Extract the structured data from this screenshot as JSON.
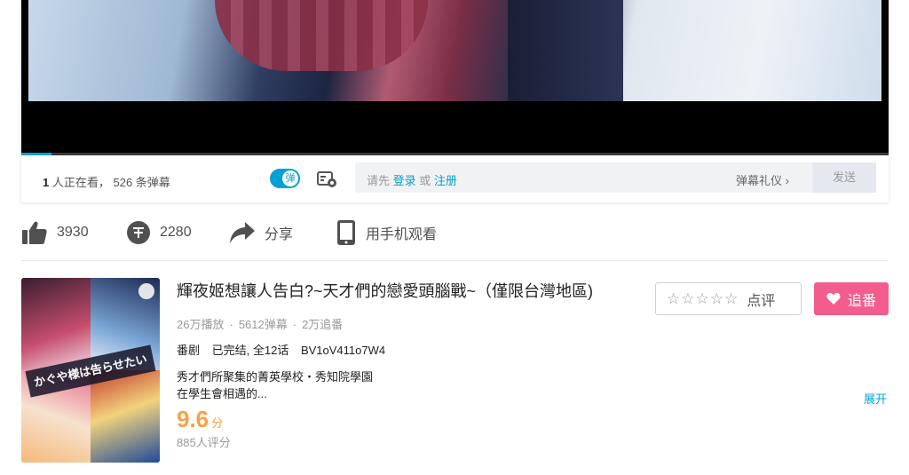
{
  "player": {
    "viewers_count": "1",
    "viewers_text": "人正在看，",
    "danmaku_count": "526 条弹幕",
    "danmaku_toggle_label": "弹",
    "input_hint_prefix": "请先",
    "login_label": "登录",
    "or_label": "或",
    "register_label": "注册",
    "etiquette_label": "弹幕礼仪 ›",
    "send_label": "发送"
  },
  "actions": {
    "like_count": "3930",
    "coin_count": "2280",
    "share_label": "分享",
    "mobile_label": "用手机观看"
  },
  "media": {
    "title": "輝夜姬想讓人告白?~天才們的戀愛頭腦戰~（僅限台灣地區)",
    "plays": "26万播放",
    "danmaku": "5612弹幕",
    "follows": "2万追番",
    "separator": "·",
    "type": "番剧",
    "status": "已完结, 全12话",
    "bvid": "BV1oV411o7W4",
    "desc_line1": "秀才們所聚集的菁英學校・秀知院學園",
    "desc_line2": "在學生會相遇的...",
    "score": "9.6",
    "score_unit": "分",
    "raters": "885人评分",
    "cover_text": "かぐや様は告らせたい"
  },
  "buttons": {
    "review_label": "点评",
    "follow_label": "追番",
    "expand_label": "展开"
  },
  "colors": {
    "accent_blue": "#00a1d6",
    "accent_pink": "#f25d8e",
    "score_orange": "#f7a245"
  }
}
